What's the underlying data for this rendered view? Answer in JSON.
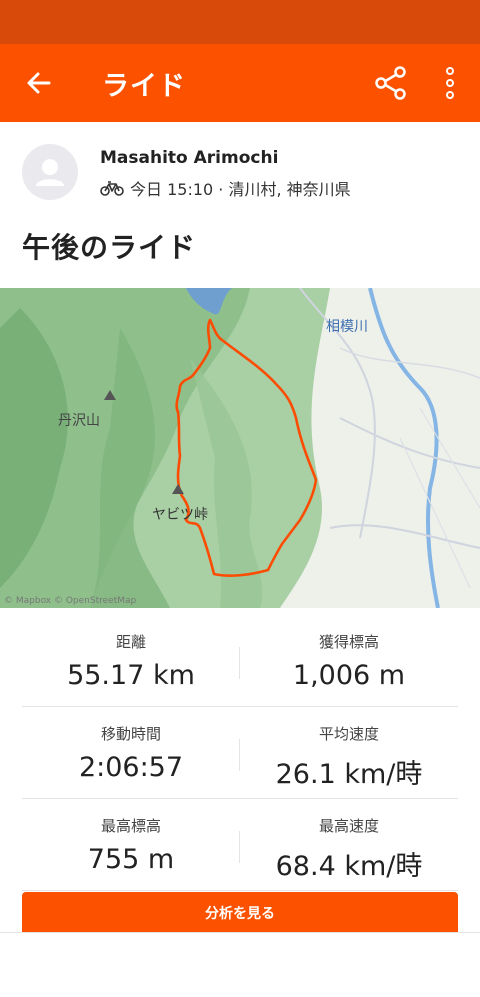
{
  "colors": {
    "brand": "#fc5200",
    "status_bar": "#d84a0a",
    "route": "#fc4c02"
  },
  "appbar": {
    "title": "ライド",
    "back_icon": "arrow-left-icon",
    "share_icon": "share-icon",
    "more_icon": "more-vertical-icon"
  },
  "athlete": {
    "name": "Masahito Arimochi",
    "activity_icon": "bicycle-icon",
    "meta": "今日 15:10 · 清川村, 神奈川県"
  },
  "activity": {
    "title": "午後のライド"
  },
  "map": {
    "labels": {
      "mountain": "丹沢山",
      "pass": "ヤビツ峠",
      "river": "相模川"
    },
    "attribution": "© Mapbox © OpenStreetMap"
  },
  "stats": [
    {
      "label": "距離",
      "value": "55.17 km"
    },
    {
      "label": "獲得標高",
      "value": "1,006 m"
    },
    {
      "label": "移動時間",
      "value": "2:06:57"
    },
    {
      "label": "平均速度",
      "value": "26.1 km/時"
    },
    {
      "label": "最高標高",
      "value": "755 m"
    },
    {
      "label": "最高速度",
      "value": "68.4 km/時"
    }
  ],
  "analyze_button": {
    "label": "分析を見る"
  }
}
